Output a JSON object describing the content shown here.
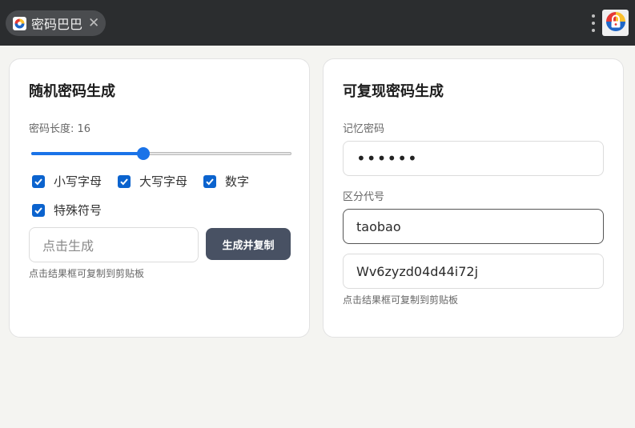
{
  "browser": {
    "tab_title": "密码巴巴",
    "tab_close": "✕",
    "favicon": "app-logo-icon",
    "menu_icon": "kebab-menu-icon",
    "extension_icon": "app-logo-icon"
  },
  "random_panel": {
    "title": "随机密码生成",
    "length_label": "密码长度: 16",
    "length_value": 16,
    "slider_fraction": 0.43,
    "options": [
      {
        "label": "小写字母",
        "checked": true
      },
      {
        "label": "大写字母",
        "checked": true
      },
      {
        "label": "数字",
        "checked": true
      },
      {
        "label": "特殊符号",
        "checked": true
      }
    ],
    "output_placeholder": "点击生成",
    "generate_button": "生成并复制",
    "hint": "点击结果框可复制到剪贴板"
  },
  "reproducible_panel": {
    "title": "可复现密码生成",
    "memory_label": "记忆密码",
    "memory_value": "••••••",
    "code_label": "区分代号",
    "code_value": "taobao",
    "result_value": "Wv6zyzd04d44i72j",
    "hint": "点击结果框可复制到剪贴板"
  },
  "colors": {
    "accent": "#1a73e8",
    "checkbox": "#0b63ce",
    "button": "#485163",
    "topbar": "#2b2d2f"
  }
}
